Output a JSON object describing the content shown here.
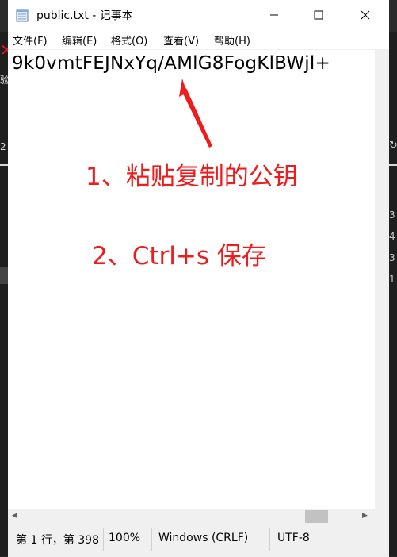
{
  "window": {
    "title": "public.txt - 记事本"
  },
  "menu": [
    "文件(F)",
    "编辑(E)",
    "格式(O)",
    "查看(V)",
    "帮助(H)"
  ],
  "editor": {
    "content": "9k0vmtFEJNxYq/AMlG8FogKlBWjl+"
  },
  "annotations": {
    "step1": "1、粘贴复制的公钥",
    "step2": "2、Ctrl+s 保存"
  },
  "status": {
    "position": "第 1 行，第 398",
    "zoom": "100%",
    "line_ending": "Windows (CRLF)",
    "encoding": "UTF-8"
  },
  "background": {
    "left_glyph": "验",
    "left_glyph2": "2",
    "right_glyph": "↻",
    "right_numbers": [
      "3",
      "4",
      "3",
      "1"
    ]
  },
  "icons": {
    "app": "notepad-icon",
    "minimize": "minimize-icon",
    "maximize": "maximize-icon",
    "close": "close-icon"
  },
  "colors": {
    "annotation": "#ee1c1c"
  }
}
